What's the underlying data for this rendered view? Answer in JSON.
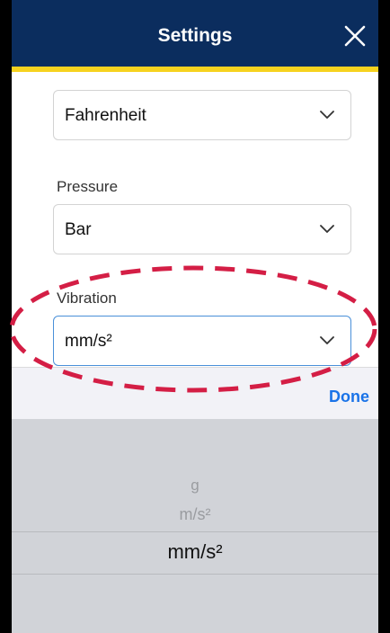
{
  "header": {
    "title": "Settings",
    "bg_color": "#0b2d5e",
    "accent_color": "#f6d21f"
  },
  "fields": {
    "temperature": {
      "value": "Fahrenheit"
    },
    "pressure": {
      "label": "Pressure",
      "value": "Bar"
    },
    "vibration": {
      "label": "Vibration",
      "value": "mm/s²"
    }
  },
  "toolbar": {
    "done_label": "Done"
  },
  "picker": {
    "options": [
      "g",
      "m/s²",
      "mm/s²"
    ],
    "selected": "mm/s²"
  },
  "annotation": {
    "color": "#d41e45",
    "icon": "dashed-ellipse-highlight"
  }
}
